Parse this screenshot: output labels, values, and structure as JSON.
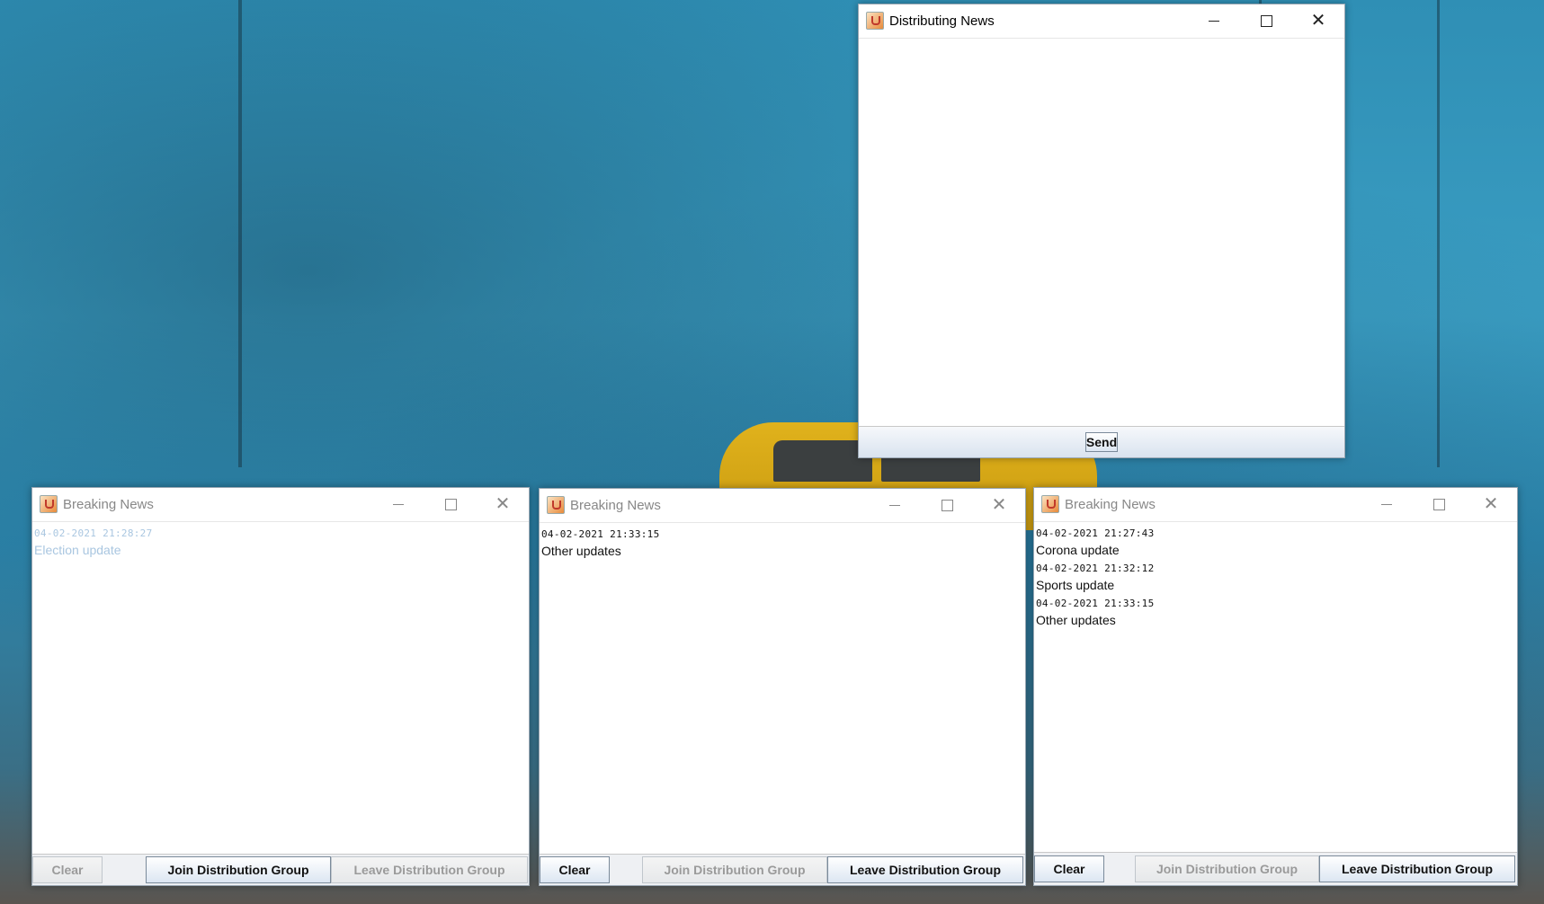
{
  "sender_window": {
    "title": "Distributing News",
    "send_label": "Send"
  },
  "receivers": [
    {
      "title": "Breaking News",
      "messages": [
        {
          "timestamp": "04-02-2021 21:28:27",
          "text": "Election update"
        }
      ],
      "clear_label": "Clear",
      "join_label": "Join Distribution Group",
      "leave_label": "Leave Distribution Group"
    },
    {
      "title": "Breaking News",
      "messages": [
        {
          "timestamp": "04-02-2021 21:33:15",
          "text": "Other updates"
        }
      ],
      "clear_label": "Clear",
      "join_label": "Join Distribution Group",
      "leave_label": "Leave Distribution Group"
    },
    {
      "title": "Breaking News",
      "messages": [
        {
          "timestamp": "04-02-2021 21:27:43",
          "text": "Corona update"
        },
        {
          "timestamp": "04-02-2021 21:32:12",
          "text": "Sports update"
        },
        {
          "timestamp": "04-02-2021 21:33:15",
          "text": "Other updates"
        }
      ],
      "clear_label": "Clear",
      "join_label": "Join Distribution Group",
      "leave_label": "Leave Distribution Group"
    }
  ],
  "icons": {
    "app": "java-coffee-icon",
    "minimize": "minimize-icon",
    "maximize": "maximize-icon",
    "close": "close-icon"
  },
  "colors": {
    "desktop_blue": "#2f8fb5",
    "button_gradient_top": "#ffffff",
    "button_gradient_bottom": "#dce6f2",
    "disabled_text": "#9a9a9a",
    "faded_message_text": "#a9c6e0"
  }
}
